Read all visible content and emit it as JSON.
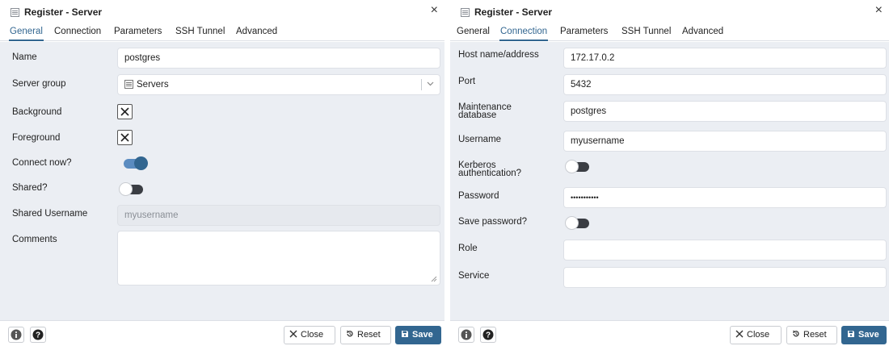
{
  "left_dialog": {
    "title": "Register - Server",
    "close_glyph": "×",
    "tabs": [
      "General",
      "Connection",
      "Parameters",
      "SSH Tunnel",
      "Advanced"
    ],
    "active_tab": "General",
    "fields": {
      "name": {
        "label": "Name",
        "value": "postgres"
      },
      "server_group": {
        "label": "Server group",
        "value": "Servers",
        "icon": "server-group-icon"
      },
      "background": {
        "label": "Background",
        "checked_glyph": "x-mark-icon"
      },
      "foreground": {
        "label": "Foreground",
        "checked_glyph": "x-mark-icon"
      },
      "connect_now": {
        "label": "Connect now?",
        "state": "on"
      },
      "shared": {
        "label": "Shared?",
        "state": "off"
      },
      "shared_username": {
        "label": "Shared Username",
        "value": "myusername",
        "disabled": true
      },
      "comments": {
        "label": "Comments",
        "value": ""
      }
    },
    "footer": {
      "info_icon": "info-icon",
      "help_icon": "help-icon",
      "close_label": "Close",
      "reset_label": "Reset",
      "save_label": "Save"
    }
  },
  "right_dialog": {
    "title": "Register - Server",
    "close_glyph": "×",
    "tabs": [
      "General",
      "Connection",
      "Parameters",
      "SSH Tunnel",
      "Advanced"
    ],
    "active_tab": "Connection",
    "fields": {
      "host": {
        "label": "Host name/address",
        "value": "172.17.0.2"
      },
      "port": {
        "label": "Port",
        "value": "5432"
      },
      "maintenance_db": {
        "label_line1": "Maintenance",
        "label_line2": "database",
        "value": "postgres"
      },
      "username": {
        "label": "Username",
        "value": "myusername"
      },
      "kerberos": {
        "label_line1": "Kerberos",
        "label_line2": "authentication?",
        "state": "off"
      },
      "password": {
        "label": "Password",
        "value": "•••••••••••"
      },
      "save_password": {
        "label": "Save password?",
        "state": "off"
      },
      "role": {
        "label": "Role",
        "value": ""
      },
      "service": {
        "label": "Service",
        "value": ""
      }
    },
    "footer": {
      "info_icon": "info-icon",
      "help_icon": "help-icon",
      "close_label": "Close",
      "reset_label": "Reset",
      "save_label": "Save"
    }
  },
  "colors": {
    "accent": "#326690",
    "toggle_on_track": "#5b8cc0",
    "toggle_off_track": "#3a3d43",
    "panel_bg": "#ebeef3",
    "input_border": "#dde0e6",
    "disabled_input_bg": "#e6e9ee"
  }
}
